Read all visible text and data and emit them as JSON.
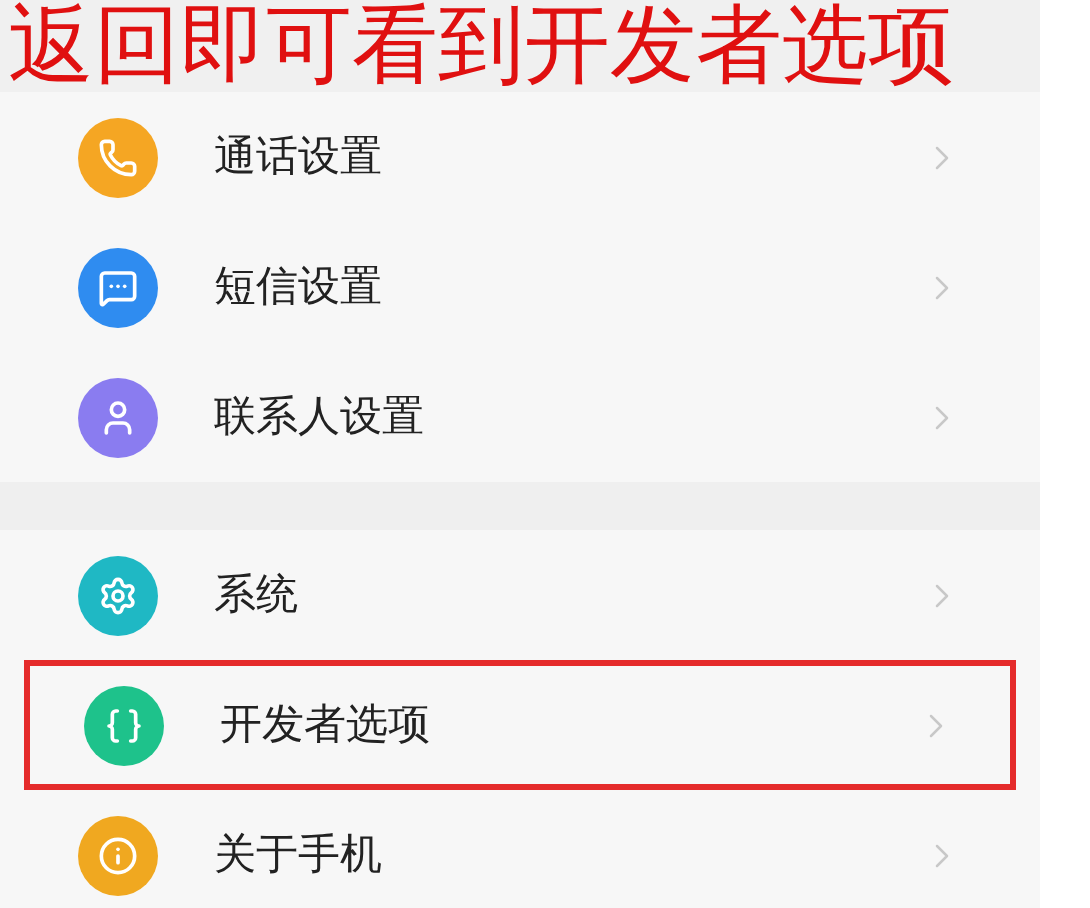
{
  "caption": "返回即可看到开发者选项",
  "groups": [
    {
      "items": [
        {
          "kind": "call",
          "label": "通话设置",
          "color": "#f5a623",
          "highlighted": false
        },
        {
          "kind": "message",
          "label": "短信设置",
          "color": "#2f8cf0",
          "highlighted": false
        },
        {
          "kind": "contacts",
          "label": "联系人设置",
          "color": "#8a7cf0",
          "highlighted": false
        }
      ]
    },
    {
      "items": [
        {
          "kind": "system",
          "label": "系统",
          "color": "#1fb8c4",
          "highlighted": false
        },
        {
          "kind": "developer",
          "label": "开发者选项",
          "color": "#1ec28b",
          "highlighted": true
        },
        {
          "kind": "about",
          "label": "关于手机",
          "color": "#f0a820",
          "highlighted": false
        }
      ]
    }
  ]
}
